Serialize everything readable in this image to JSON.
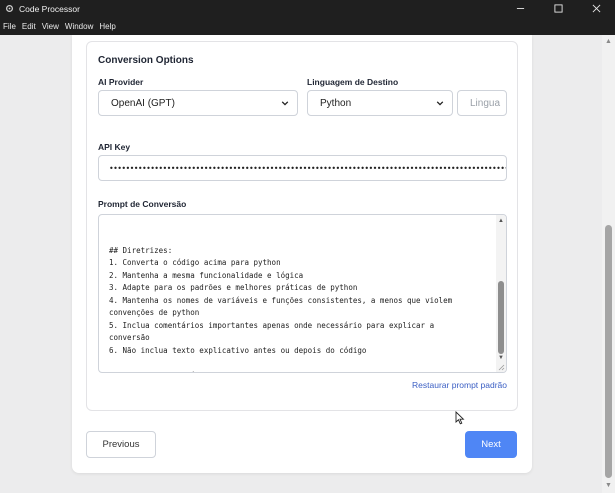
{
  "window": {
    "title": "Code Processor"
  },
  "menu": {
    "items": [
      "File",
      "Edit",
      "View",
      "Window",
      "Help"
    ]
  },
  "conversion": {
    "section_title": "Conversion Options",
    "ai_provider_label": "AI Provider",
    "ai_provider_value": "OpenAI (GPT)",
    "target_language_label": "Linguagem de Destino",
    "target_language_value": "Python",
    "language_input_placeholder": "Lingua",
    "api_key_label": "API Key",
    "api_key_value": "••••••••••••••••••••••••••••••••••••••••••••••••••••••••••••••••••••••••••••••••••••••••••••••••••••••",
    "prompt_label": "Prompt de Conversão",
    "prompt_lines": [
      "",
      "## Diretrizes:",
      "1. Converta o código acima para python",
      "2. Mantenha a mesma funcionalidade e lógica",
      "3. Adapte para os padrões e melhores práticas de python",
      "4. Mantenha os nomes de variáveis e funções consistentes, a menos que violem",
      "convenções de python",
      "5. Inclua comentários importantes apenas onde necessário para explicar a",
      "conversão",
      "6. Não inclua texto explicativo antes ou depois do código",
      "",
      "Retorne apenas o código convertido em python, sem explicações adicionais."
    ],
    "restore_link": "Restaurar prompt padrão"
  },
  "nav": {
    "previous_label": "Previous",
    "next_label": "Next"
  },
  "colors": {
    "accent": "#4f86f5",
    "link": "#3b5fc4",
    "titlebar": "#1f1f1f"
  }
}
